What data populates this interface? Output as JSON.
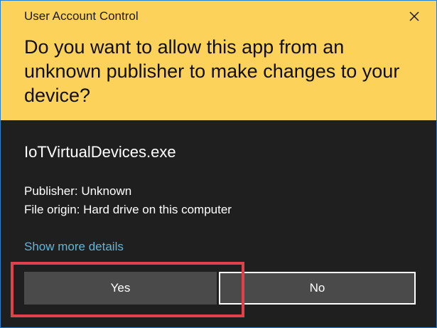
{
  "window": {
    "title": "User Account Control",
    "close_icon": "close-icon"
  },
  "banner": {
    "question": "Do you want to allow this app from an unknown publisher to make changes to your device?",
    "color": "#fcd25b"
  },
  "app": {
    "name": "IoTVirtualDevices.exe",
    "publisher": "Publisher: Unknown",
    "origin": "File origin: Hard drive on this computer"
  },
  "links": {
    "show_more": "Show more details"
  },
  "buttons": {
    "yes": "Yes",
    "no": "No"
  },
  "colors": {
    "background": "#1f1f1f",
    "link": "#5fb6d9",
    "button": "#4a4a4a",
    "highlight": "#e2404a"
  }
}
